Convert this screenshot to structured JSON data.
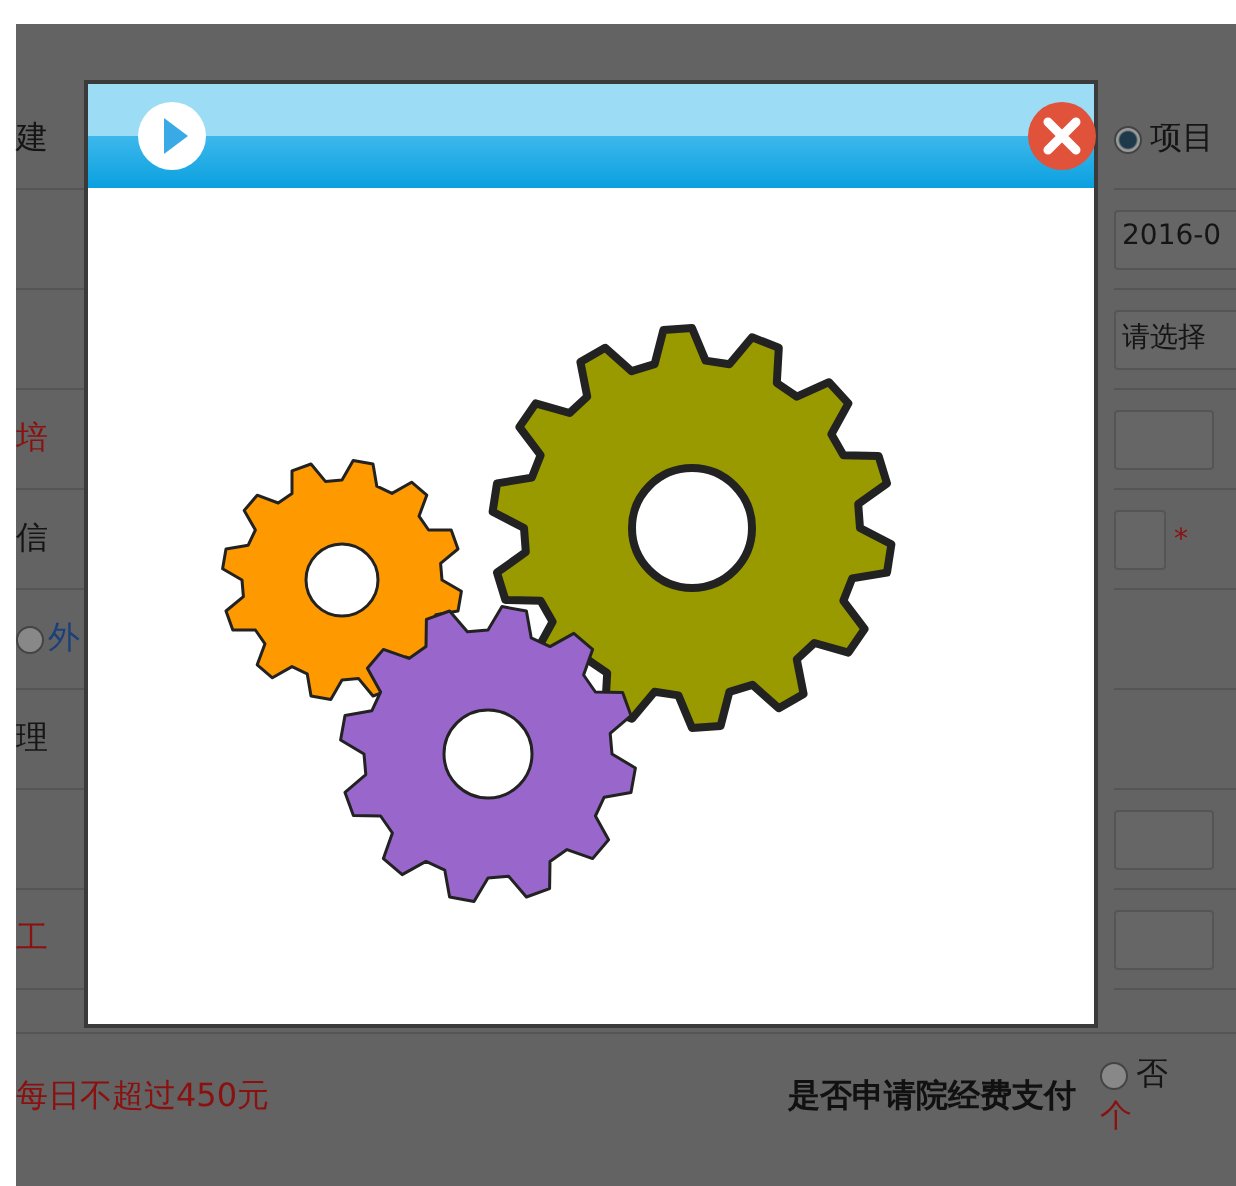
{
  "left_rows": [
    {
      "kind": "label",
      "text": "建"
    },
    {
      "kind": "empty"
    },
    {
      "kind": "empty"
    },
    {
      "kind": "warning",
      "text": "培"
    },
    {
      "kind": "label",
      "text": "信"
    },
    {
      "kind": "radio",
      "text": "外",
      "checked": false
    },
    {
      "kind": "label",
      "text": "理"
    },
    {
      "kind": "empty"
    },
    {
      "kind": "warning",
      "text": "工"
    }
  ],
  "right_rows": [
    {
      "kind": "radio",
      "label": "项目",
      "checked": true
    },
    {
      "kind": "input",
      "value": "2016-0"
    },
    {
      "kind": "select",
      "value": "请选择"
    },
    {
      "kind": "input"
    },
    {
      "kind": "input",
      "required_mark": "*"
    },
    {
      "kind": "empty"
    },
    {
      "kind": "empty"
    },
    {
      "kind": "input"
    },
    {
      "kind": "input"
    }
  ],
  "bottom_row": {
    "note": "每日不超过450元",
    "label": "是否申请院经费支付",
    "option": {
      "label": "否",
      "checked": false
    },
    "unit": "个"
  },
  "dialog": {
    "gears": [
      {
        "color": "#999900"
      },
      {
        "color": "#ff9900"
      },
      {
        "color": "#9966cc"
      }
    ]
  }
}
